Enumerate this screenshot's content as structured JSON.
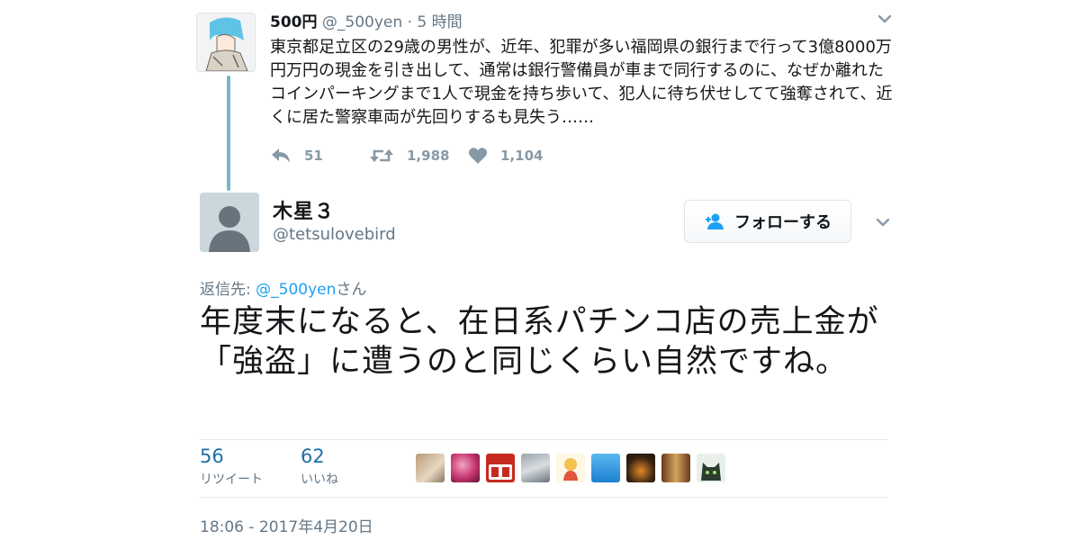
{
  "parent_tweet": {
    "name": "500円",
    "handle": "@_500yen",
    "separator": "·",
    "time": "5 時間",
    "text": "東京都足立区の29歳の男性が、近年、犯罪が多い福岡県の銀行まで行って3億8000万円万円の現金を引き出して、通常は銀行警備員が車まで同行するのに、なぜか離れたコインパーキングまで1人で現金を持ち歩いて、犯人に待ち伏せしてて強奪されて、近くに居た警察車両が先回りするも見失う……",
    "reply_count": "51",
    "retweet_count": "1,988",
    "like_count": "1,104"
  },
  "reply_tweet": {
    "name": "木星３",
    "handle": "@tetsulovebird",
    "follow_label": "フォローする",
    "reply_to_prefix": "返信先: ",
    "reply_to_mention": "@_500yen",
    "reply_to_suffix": "さん",
    "text": "年度末になると、在日系パチンコ店の売上金が「強盗」に遭うのと同じくらい自然ですね。",
    "retweets": "56",
    "retweets_label": "リツイート",
    "likes": "62",
    "likes_label": "いいね",
    "timestamp": "18:06 - 2017年4月20日"
  },
  "colors": {
    "accent": "#1da1f2",
    "stat_number": "#1d6fa5",
    "thread_line": "#74b9c9",
    "muted": "#657786",
    "action_gray": "#8899a6"
  },
  "icons": {
    "reply": "reply-icon",
    "retweet": "retweet-icon",
    "like": "heart-icon",
    "follow": "add-user-icon",
    "menu": "chevron-down-icon"
  }
}
